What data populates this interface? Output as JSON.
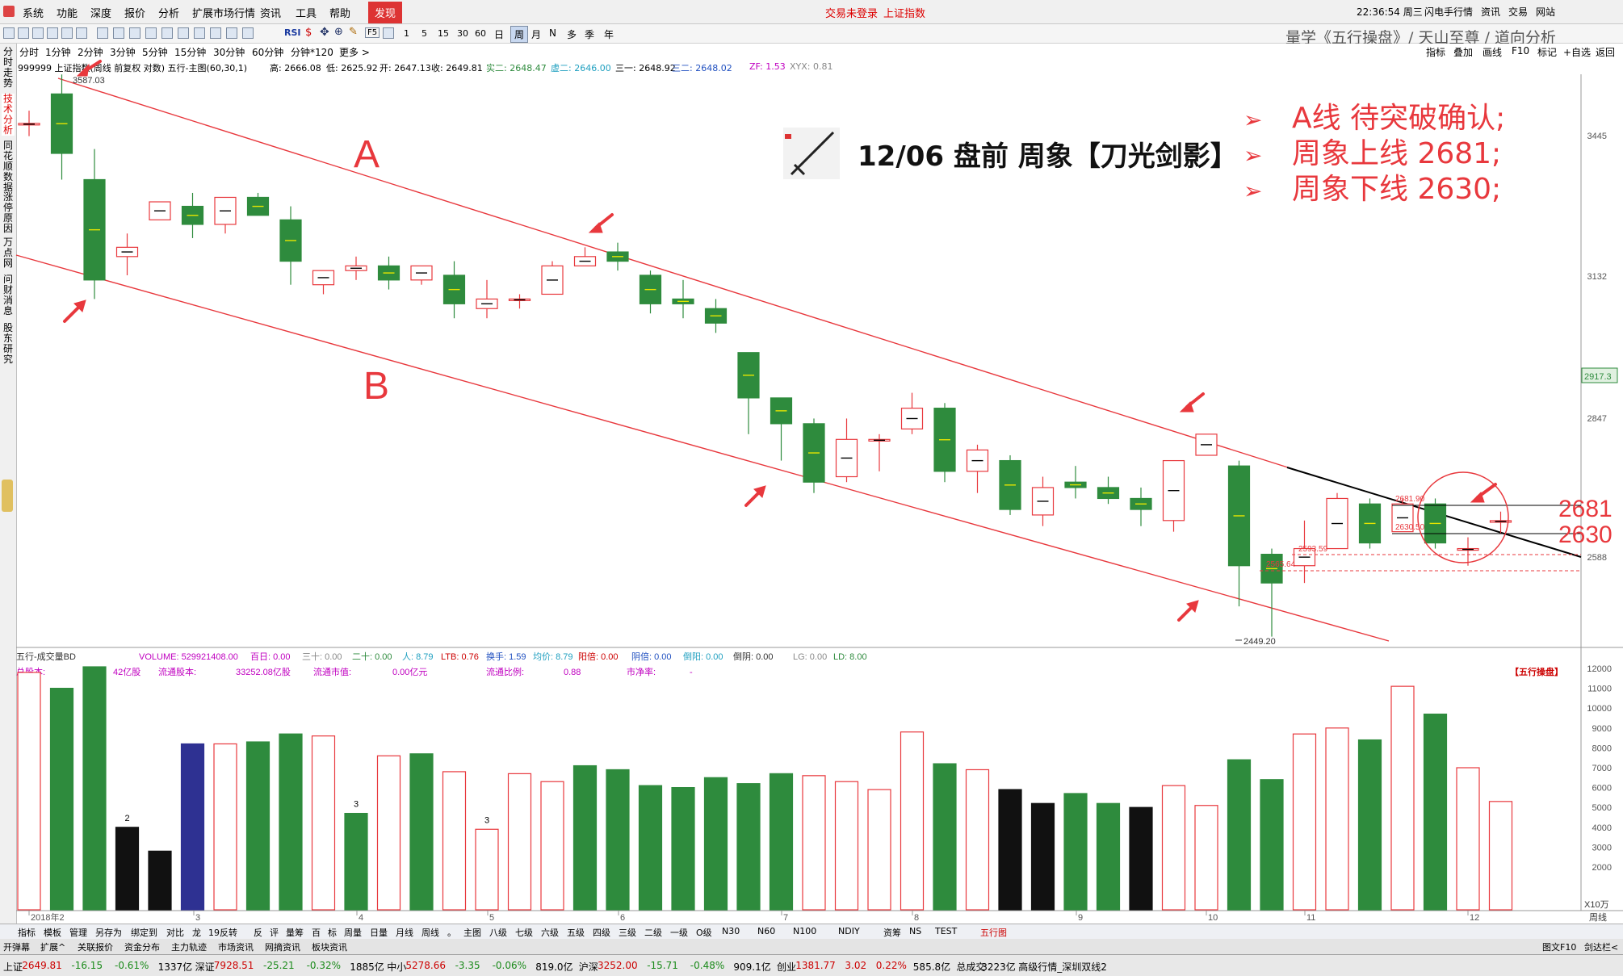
{
  "colors": {
    "up": "#e8383d",
    "down": "#2e8b3d",
    "black": "#111111",
    "blue": "#2e3192",
    "channel": "#e8383d",
    "trend": "#000000",
    "annotation": "#e8383d"
  },
  "menu": {
    "items": [
      "系统",
      "功能",
      "深度",
      "报价",
      "分析",
      "扩展市场行情",
      "资讯",
      "工具",
      "帮助"
    ],
    "active": "发现",
    "status": "交易未登录",
    "index_name": "上证指数",
    "time": "22:36:54 周三",
    "right_items": [
      "闪电手",
      "行情",
      "资讯",
      "交易",
      "网站"
    ]
  },
  "toolbar": {
    "numbers": [
      "1",
      "5",
      "15",
      "30",
      "60"
    ],
    "periods": [
      "日",
      "周",
      "月",
      "N",
      "多",
      "季",
      "年"
    ],
    "icons": [
      "back-icon",
      "forward-icon",
      "up-icon",
      "down-icon",
      "chart-icon",
      "grid-icon",
      "kline-icon",
      "line-icon",
      "f10-icon",
      "refresh-icon",
      "rsi-label",
      "dollar-icon",
      "move-icon",
      "zoom-icon",
      "pen-icon"
    ],
    "rsi": "RSI",
    "f5": "F5"
  },
  "header_title": "量学《五行操盘》/ 天山至尊 / 道向分析",
  "periodbar": {
    "items": [
      "分时",
      "1分钟",
      "2分钟",
      "3分钟",
      "5分钟",
      "15分钟",
      "30分钟",
      "60分钟",
      "分钟*120",
      "更多 >"
    ],
    "right": [
      "指标",
      "叠加",
      "画线",
      "F10",
      "标记",
      "+自选",
      "返回"
    ]
  },
  "infobar": {
    "code": "999999 上证指数(周线 前复权 对数) 五行-主图(60,30,1)",
    "high": "高: 2666.08",
    "low": "低: 2625.92",
    "open": "开: 2647.13",
    "close": "收: 2649.81",
    "s2": "实二: 2648.47",
    "x2": "虚二: 2646.00",
    "t1": "三一: 2648.92",
    "t2": "三二: 2648.02",
    "zf": "ZF: 1.53",
    "xyx": "XYX: 0.81"
  },
  "sidetabs": [
    "分时走势",
    "技术分析",
    "同花顺数据",
    "涨停原因",
    "万点网",
    "问财消息",
    "股东研究"
  ],
  "annotation": {
    "title": "12/06 盘前 周象【刀光剑影】",
    "lines": [
      "A线 待突破确认;",
      "周象上线 2681;",
      "周象下线 2630;"
    ],
    "label_a": "A",
    "label_b": "B",
    "big_2681": "2681",
    "big_2630": "2630"
  },
  "price_labels": {
    "top": "3587.03",
    "bottom": "2449.20",
    "l2681": "2681.90",
    "l2630": "2630.50",
    "l2593": "2593.59",
    "l2565": "2565.64"
  },
  "price_axis": [
    "3445",
    "3132",
    "2847",
    "2588"
  ],
  "current_price": "2917.3",
  "vol_info": {
    "name": "五行-成交量BD",
    "volume": "VOLUME: 529921408.00",
    "b100": "百日: 0.00",
    "b30": "三十: 0.00",
    "b20": "二十: 0.00",
    "ren": "人: 8.79",
    "ltb": "LTB: 0.76",
    "hs": "换手: 1.59",
    "jj": "均价: 8.79",
    "yb": "阳倍: 0.00",
    "yinb": "阴倍: 0.00",
    "lb": "倒阳: 0.00",
    "qj": "倒阴: 0.00",
    "lg": "LG: 0.00",
    "ld": "LD: 8.00"
  },
  "vol_info2": {
    "zgb": "总股本:",
    "zgb_v": "42亿股",
    "ltgb": "流通股本:",
    "ltgb_v": "33252.08亿股",
    "ltsz": "流通市值:",
    "ltsz_v": "0.00亿元",
    "ltbl": "流通比例:",
    "ltbl_v": "0.88",
    "sjl": "市净率:",
    "sjl_v": "-",
    "brand": "【五行操盘】"
  },
  "vol_axis": [
    "12000",
    "11000",
    "10000",
    "9000",
    "8000",
    "7000",
    "6000",
    "5000",
    "4000",
    "3000",
    "2000"
  ],
  "vol_unit": "X10万",
  "date_axis": [
    "2018年2",
    "3",
    "4",
    "5",
    "6",
    "7",
    "8",
    "9",
    "10",
    "11",
    "12"
  ],
  "vol_marks": [
    "2",
    "3",
    "3"
  ],
  "chart_data": {
    "type": "candlestick",
    "title": "999999 上证指数 周线",
    "candles": [
      {
        "o": 3470,
        "c": 3470,
        "h": 3500,
        "l": 3440
      },
      {
        "o": 3540,
        "c": 3400,
        "h": 3587,
        "l": 3340
      },
      {
        "o": 3340,
        "c": 3120,
        "h": 3410,
        "l": 3080
      },
      {
        "o": 3170,
        "c": 3190,
        "h": 3220,
        "l": 3130
      },
      {
        "o": 3250,
        "c": 3290,
        "h": 3290,
        "l": 3250
      },
      {
        "o": 3280,
        "c": 3240,
        "h": 3310,
        "l": 3210
      },
      {
        "o": 3240,
        "c": 3300,
        "h": 3300,
        "l": 3220
      },
      {
        "o": 3300,
        "c": 3260,
        "h": 3310,
        "l": 3260
      },
      {
        "o": 3250,
        "c": 3160,
        "h": 3280,
        "l": 3110
      },
      {
        "o": 3110,
        "c": 3140,
        "h": 3140,
        "l": 3090
      },
      {
        "o": 3140,
        "c": 3150,
        "h": 3170,
        "l": 3120
      },
      {
        "o": 3150,
        "c": 3120,
        "h": 3170,
        "l": 3100
      },
      {
        "o": 3120,
        "c": 3150,
        "h": 3150,
        "l": 3110
      },
      {
        "o": 3130,
        "c": 3070,
        "h": 3160,
        "l": 3040
      },
      {
        "o": 3060,
        "c": 3080,
        "h": 3120,
        "l": 3040
      },
      {
        "o": 3080,
        "c": 3080,
        "h": 3090,
        "l": 3060
      },
      {
        "o": 3090,
        "c": 3150,
        "h": 3160,
        "l": 3090
      },
      {
        "o": 3150,
        "c": 3170,
        "h": 3190,
        "l": 3160
      },
      {
        "o": 3180,
        "c": 3160,
        "h": 3200,
        "l": 3140
      },
      {
        "o": 3130,
        "c": 3070,
        "h": 3140,
        "l": 3050
      },
      {
        "o": 3080,
        "c": 3070,
        "h": 3120,
        "l": 3040
      },
      {
        "o": 3060,
        "c": 3030,
        "h": 3080,
        "l": 3010
      },
      {
        "o": 2970,
        "c": 2880,
        "h": 2970,
        "l": 2810
      },
      {
        "o": 2880,
        "c": 2830,
        "h": 2880,
        "l": 2760
      },
      {
        "o": 2830,
        "c": 2720,
        "h": 2840,
        "l": 2700
      },
      {
        "o": 2730,
        "c": 2800,
        "h": 2840,
        "l": 2720
      },
      {
        "o": 2800,
        "c": 2800,
        "h": 2810,
        "l": 2740
      },
      {
        "o": 2820,
        "c": 2860,
        "h": 2890,
        "l": 2810
      },
      {
        "o": 2860,
        "c": 2740,
        "h": 2870,
        "l": 2720
      },
      {
        "o": 2740,
        "c": 2780,
        "h": 2790,
        "l": 2700
      },
      {
        "o": 2760,
        "c": 2670,
        "h": 2770,
        "l": 2660
      },
      {
        "o": 2660,
        "c": 2710,
        "h": 2730,
        "l": 2640
      },
      {
        "o": 2720,
        "c": 2710,
        "h": 2750,
        "l": 2690
      },
      {
        "o": 2710,
        "c": 2690,
        "h": 2730,
        "l": 2680
      },
      {
        "o": 2690,
        "c": 2670,
        "h": 2710,
        "l": 2640
      },
      {
        "o": 2650,
        "c": 2760,
        "h": 2760,
        "l": 2630
      },
      {
        "o": 2770,
        "c": 2810,
        "h": 2810,
        "l": 2770
      },
      {
        "o": 2750,
        "c": 2570,
        "h": 2760,
        "l": 2500
      },
      {
        "o": 2590,
        "c": 2540,
        "h": 2600,
        "l": 2449.2
      },
      {
        "o": 2570,
        "c": 2600,
        "h": 2650,
        "l": 2540
      },
      {
        "o": 2600,
        "c": 2690,
        "h": 2700,
        "l": 2600
      },
      {
        "o": 2680,
        "c": 2610,
        "h": 2690,
        "l": 2600
      },
      {
        "o": 2630,
        "c": 2680,
        "h": 2690,
        "l": 2630
      },
      {
        "o": 2680,
        "c": 2610,
        "h": 2690,
        "l": 2600
      },
      {
        "o": 2600,
        "c": 2600,
        "h": 2620,
        "l": 2570
      },
      {
        "o": 2647.13,
        "c": 2649.81,
        "h": 2666.08,
        "l": 2625.92
      }
    ],
    "volume": [
      {
        "v": 11800,
        "c": "up"
      },
      {
        "v": 11000,
        "c": "down"
      },
      {
        "v": 12300,
        "c": "down"
      },
      {
        "v": 4000,
        "c": "black"
      },
      {
        "v": 2800,
        "c": "black"
      },
      {
        "v": 8200,
        "c": "blue"
      },
      {
        "v": 8200,
        "c": "up"
      },
      {
        "v": 8300,
        "c": "down"
      },
      {
        "v": 8700,
        "c": "down"
      },
      {
        "v": 8600,
        "c": "up"
      },
      {
        "v": 4700,
        "c": "down"
      },
      {
        "v": 7600,
        "c": "up"
      },
      {
        "v": 7700,
        "c": "down"
      },
      {
        "v": 6800,
        "c": "up"
      },
      {
        "v": 3900,
        "c": "up"
      },
      {
        "v": 6700,
        "c": "up"
      },
      {
        "v": 6300,
        "c": "up"
      },
      {
        "v": 7100,
        "c": "down"
      },
      {
        "v": 6900,
        "c": "down"
      },
      {
        "v": 6100,
        "c": "down"
      },
      {
        "v": 6000,
        "c": "down"
      },
      {
        "v": 6500,
        "c": "down"
      },
      {
        "v": 6200,
        "c": "down"
      },
      {
        "v": 6700,
        "c": "down"
      },
      {
        "v": 6600,
        "c": "up"
      },
      {
        "v": 6300,
        "c": "up"
      },
      {
        "v": 5900,
        "c": "up"
      },
      {
        "v": 8800,
        "c": "up"
      },
      {
        "v": 7200,
        "c": "down"
      },
      {
        "v": 6900,
        "c": "up"
      },
      {
        "v": 5900,
        "c": "black"
      },
      {
        "v": 5200,
        "c": "black"
      },
      {
        "v": 5700,
        "c": "down"
      },
      {
        "v": 5200,
        "c": "down"
      },
      {
        "v": 5000,
        "c": "black"
      },
      {
        "v": 6100,
        "c": "up"
      },
      {
        "v": 5100,
        "c": "up"
      },
      {
        "v": 7400,
        "c": "down"
      },
      {
        "v": 6400,
        "c": "down"
      },
      {
        "v": 8700,
        "c": "up"
      },
      {
        "v": 9000,
        "c": "up"
      },
      {
        "v": 8400,
        "c": "down"
      },
      {
        "v": 11100,
        "c": "up"
      },
      {
        "v": 9700,
        "c": "down"
      },
      {
        "v": 7000,
        "c": "up"
      },
      {
        "v": 5300,
        "c": "up"
      }
    ]
  },
  "statusbar": {
    "items": [
      "上证",
      "2649.81",
      "-16.15",
      "-0.61%",
      "1337亿",
      "深证",
      "7928.51",
      "-25.21",
      "-0.32%",
      "1885亿",
      "中小",
      "5278.66",
      "-3.35",
      "-0.06%",
      "819.0亿",
      "沪深",
      "3252.00",
      "-15.71",
      "-0.48%",
      "909.1亿",
      "创业",
      "1381.77",
      "3.02",
      "0.22%",
      "585.8亿",
      "总成交",
      "3223亿",
      "高级行情_深圳双线2"
    ]
  },
  "bottomtabs": [
    "指标",
    "模板",
    "管理",
    "另存为",
    "绑定到",
    "对比",
    "龙",
    "19反转",
    "反",
    "评",
    "量筹",
    "百",
    "标",
    "周量",
    "日量",
    "月线",
    "周线",
    "。",
    "主图",
    "八级",
    "七级",
    "六级",
    "五级",
    "四级",
    "三级",
    "二级",
    "一级",
    "O级",
    "N30",
    "N60",
    "N100",
    "NDIY",
    "资筹",
    "NS",
    "TEST",
    "五行图"
  ],
  "bottomtabs2": [
    "开弹幕",
    "扩展^",
    "关联报价",
    "资金分布",
    "主力轨迹",
    "市场资讯",
    "网摘资讯",
    "板块资讯"
  ],
  "bottom_right": [
    "图文F10",
    "剑达栏<"
  ],
  "bottom_right_label": "周线"
}
